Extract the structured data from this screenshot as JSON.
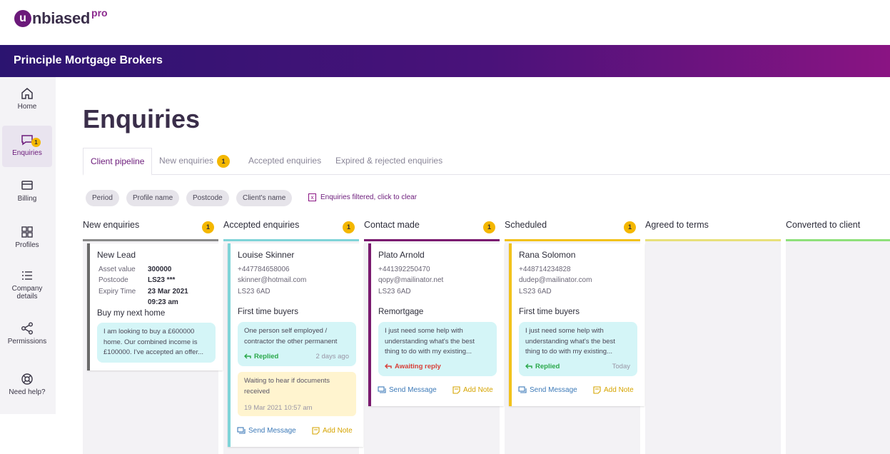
{
  "brand": {
    "logo_letter": "u",
    "logo_text": "nbiased",
    "logo_pro": "pro"
  },
  "banner": {
    "title": "Principle Mortgage Brokers"
  },
  "sidebar": {
    "items": [
      {
        "label": "Home"
      },
      {
        "label": "Enquiries",
        "badge": "1"
      },
      {
        "label": "Billing"
      },
      {
        "label": "Profiles"
      },
      {
        "label": "Company details"
      },
      {
        "label": "Permissions"
      },
      {
        "label": "Need help?"
      }
    ]
  },
  "page": {
    "title": "Enquiries"
  },
  "tabs": [
    {
      "label": "Client pipeline"
    },
    {
      "label": "New enquiries",
      "badge": "1"
    },
    {
      "label": "Accepted enquiries"
    },
    {
      "label": "Expired & rejected enquiries"
    }
  ],
  "filters": {
    "chips": [
      "Period",
      "Profile name",
      "Postcode",
      "Client's name"
    ],
    "clear_label": "Enquiries filtered, click to clear",
    "clear_icon": "x"
  },
  "columns": [
    {
      "title": "New enquiries",
      "count": "1",
      "color": "#8a8a8a"
    },
    {
      "title": "Accepted enquiries",
      "count": "1",
      "color": "#7fd4d8"
    },
    {
      "title": "Contact made",
      "count": "1",
      "color": "#7a1a6f"
    },
    {
      "title": "Scheduled",
      "count": "1",
      "color": "#f2c21b"
    },
    {
      "title": "Agreed to terms",
      "count": "",
      "color": "#e8e07a"
    },
    {
      "title": "Converted to client",
      "count": "",
      "color": "#8ee07a"
    }
  ],
  "cards": {
    "new_lead": {
      "name": "New Lead",
      "asset_label": "Asset value",
      "asset_value": "300000",
      "postcode_label": "Postcode",
      "postcode_value": "LS23 ***",
      "expiry_label": "Expiry Time",
      "expiry_date": "23 Mar 2021",
      "expiry_time": "09:23 am",
      "goal": "Buy my next home",
      "message": "I am looking to buy a £600000 home. Our combined income is £100000. I've accepted an offer..."
    },
    "louise": {
      "name": "Louise Skinner",
      "phone": "+447784658006",
      "email": "skinner@hotmail.com",
      "postcode": "LS23 6AD",
      "goal": "First time buyers",
      "message": "One person self employed / contractor the other permanent",
      "status": "Replied",
      "time": "2 days ago",
      "note": "Waiting to hear if documents received",
      "note_time": "19 Mar 2021 10:57 am",
      "send_label": "Send Message",
      "note_label": "Add Note"
    },
    "plato": {
      "name": "Plato Arnold",
      "phone": "+441392250470",
      "email": "qopy@mailinator.net",
      "postcode": "LS23 6AD",
      "goal": "Remortgage",
      "message": "I just need some help with understanding what's the best thing to do with my existing...",
      "status": "Awaiting reply",
      "send_label": "Send Message",
      "note_label": "Add Note"
    },
    "rana": {
      "name": "Rana Solomon",
      "phone": "+448714234828",
      "email": "dudep@mailinator.com",
      "postcode": "LS23 6AD",
      "goal": "First time buyers",
      "message": "I just need some help with understanding what's the best thing to do with my existing...",
      "status": "Replied",
      "time": "Today",
      "send_label": "Send Message",
      "note_label": "Add Note"
    }
  },
  "colors": {
    "accent": "#6b1a7a",
    "badge": "#f4b700",
    "replied": "#2aa84a",
    "awaiting": "#d8403a",
    "send": "#3d7ab8",
    "note": "#d6a400"
  }
}
